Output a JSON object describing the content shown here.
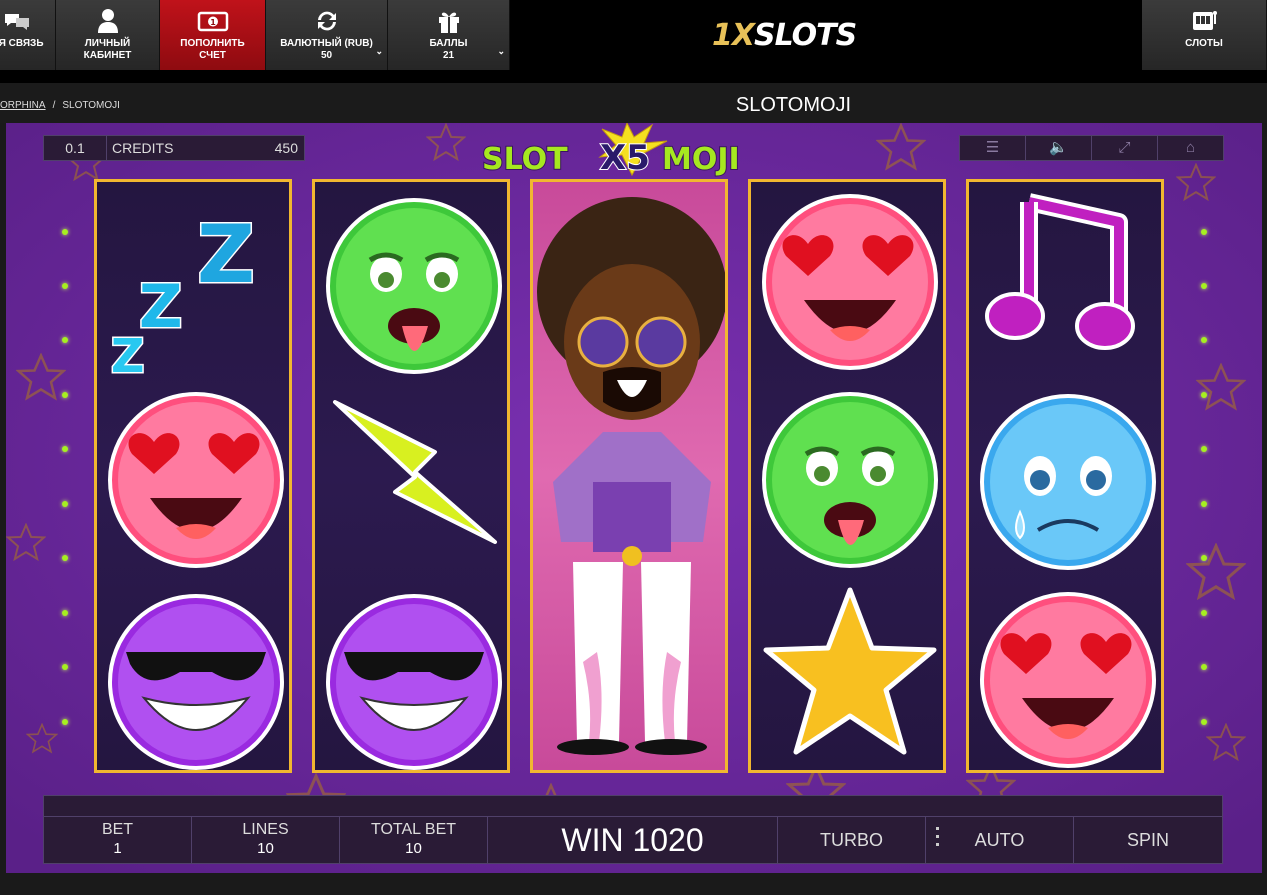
{
  "nav": {
    "feedback": "АЯ СВЯЗЬ",
    "cabinet": [
      "ЛИЧНЫЙ",
      "КАБИНЕТ"
    ],
    "deposit": [
      "ПОПОЛНИТЬ",
      "СЧЕТ"
    ],
    "currency": [
      "ВАЛЮТНЫЙ (RUB)",
      "50"
    ],
    "points": [
      "БАЛЛЫ",
      "21"
    ],
    "slots": "СЛОТЫ",
    "logo_one": "1X",
    "logo_rest": "SLOTS"
  },
  "breadcrumb": {
    "provider": "ORPHINA",
    "sep": "/",
    "current": "SLOTOMOJI"
  },
  "page_title": "SLOTOMOJI",
  "game": {
    "logo": {
      "left": "SLOT",
      "mid": "X5",
      "right": "MOJI"
    },
    "hud": {
      "bet": "0.1",
      "credits_label": "CREDITS",
      "credits_value": "450"
    },
    "top_icons": [
      "menu-icon",
      "sound-icon",
      "fullscreen-icon",
      "home-icon"
    ],
    "reels": [
      [
        "zzz",
        "heart-eyes",
        "cool"
      ],
      [
        "sick",
        "lightning",
        "cool"
      ],
      [
        "disco-wild"
      ],
      [
        "heart-eyes",
        "sick",
        "star"
      ],
      [
        "music-note",
        "sad",
        "heart-eyes"
      ]
    ],
    "panel": {
      "bet_label": "BET",
      "bet_value": "1",
      "lines_label": "LINES",
      "lines_value": "10",
      "total_label": "TOTAL BET",
      "total_value": "10",
      "win": "WIN 1020",
      "turbo": "TURBO",
      "auto": "AUTO",
      "spin": "SPIN"
    }
  }
}
